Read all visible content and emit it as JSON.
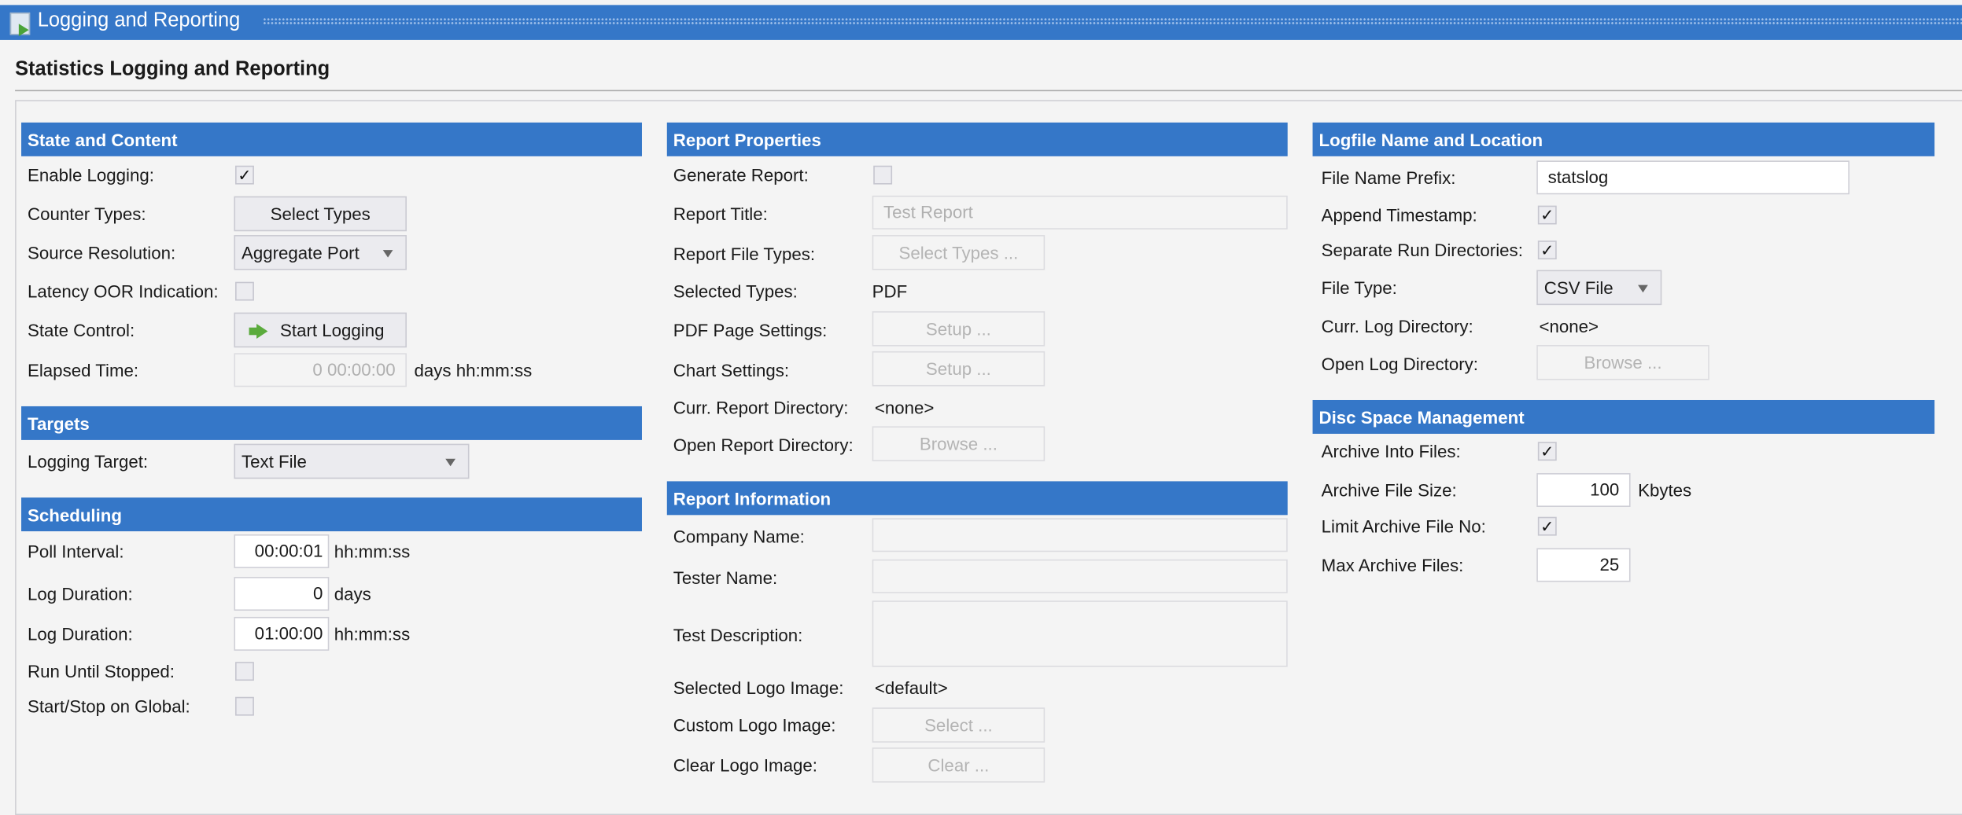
{
  "window": {
    "title": "Logging and Reporting",
    "colors": {
      "accent": "#3577c8"
    }
  },
  "page": {
    "heading": "Statistics Logging and Reporting"
  },
  "state": {
    "header": "State and Content",
    "enable_logging": {
      "label": "Enable Logging:",
      "checked": true
    },
    "counter_types": {
      "label": "Counter Types:",
      "button": "Select Types"
    },
    "source_resolution": {
      "label": "Source Resolution:",
      "value": "Aggregate Port"
    },
    "latency_oor": {
      "label": "Latency OOR Indication:",
      "checked": false
    },
    "state_control": {
      "label": "State Control:",
      "button": "Start Logging"
    },
    "elapsed": {
      "label": "Elapsed Time:",
      "value": "0 00:00:00",
      "unit": "days hh:mm:ss"
    }
  },
  "targets": {
    "header": "Targets",
    "logging_target": {
      "label": "Logging Target:",
      "value": "Text File"
    }
  },
  "scheduling": {
    "header": "Scheduling",
    "poll_interval": {
      "label": "Poll Interval:",
      "value": "00:00:01",
      "unit": "hh:mm:ss"
    },
    "log_duration_days": {
      "label": "Log Duration:",
      "value": "0",
      "unit": "days"
    },
    "log_duration_time": {
      "label": "Log Duration:",
      "value": "01:00:00",
      "unit": "hh:mm:ss"
    },
    "run_until_stopped": {
      "label": "Run Until Stopped:",
      "checked": false
    },
    "start_stop_global": {
      "label": "Start/Stop on Global:",
      "checked": false
    }
  },
  "report_properties": {
    "header": "Report Properties",
    "generate": {
      "label": "Generate Report:",
      "checked": false
    },
    "title": {
      "label": "Report Title:",
      "placeholder": "Test Report"
    },
    "file_types": {
      "label": "Report File Types:",
      "button": "Select Types ..."
    },
    "selected_types": {
      "label": "Selected Types:",
      "value": "PDF"
    },
    "pdf_page": {
      "label": "PDF Page Settings:",
      "button": "Setup ..."
    },
    "chart": {
      "label": "Chart Settings:",
      "button": "Setup ..."
    },
    "curr_dir": {
      "label": "Curr. Report Directory:",
      "value": "<none>"
    },
    "open_dir": {
      "label": "Open Report Directory:",
      "button": "Browse ..."
    }
  },
  "report_info": {
    "header": "Report Information",
    "company": {
      "label": "Company Name:",
      "value": ""
    },
    "tester": {
      "label": "Tester Name:",
      "value": ""
    },
    "description": {
      "label": "Test Description:",
      "value": ""
    },
    "selected_logo": {
      "label": "Selected Logo Image:",
      "value": "<default>"
    },
    "custom_logo": {
      "label": "Custom Logo Image:",
      "button": "Select ..."
    },
    "clear_logo": {
      "label": "Clear Logo Image:",
      "button": "Clear ..."
    }
  },
  "logfile": {
    "header": "Logfile Name and Location",
    "prefix": {
      "label": "File Name Prefix:",
      "value": "statslog"
    },
    "append_ts": {
      "label": "Append Timestamp:",
      "checked": true
    },
    "separate_runs": {
      "label": "Separate Run Directories:",
      "checked": true
    },
    "file_type": {
      "label": "File Type:",
      "value": "CSV File"
    },
    "curr_dir": {
      "label": "Curr. Log Directory:",
      "value": "<none>"
    },
    "open_dir": {
      "label": "Open Log Directory:",
      "button": "Browse ..."
    }
  },
  "disc": {
    "header": "Disc Space Management",
    "archive_into": {
      "label": "Archive Into Files:",
      "checked": true
    },
    "file_size": {
      "label": "Archive File Size:",
      "value": "100",
      "unit": "Kbytes"
    },
    "limit_no": {
      "label": "Limit Archive File No:",
      "checked": true
    },
    "max_files": {
      "label": "Max Archive Files:",
      "value": "25"
    }
  },
  "check_glyph": "✓"
}
